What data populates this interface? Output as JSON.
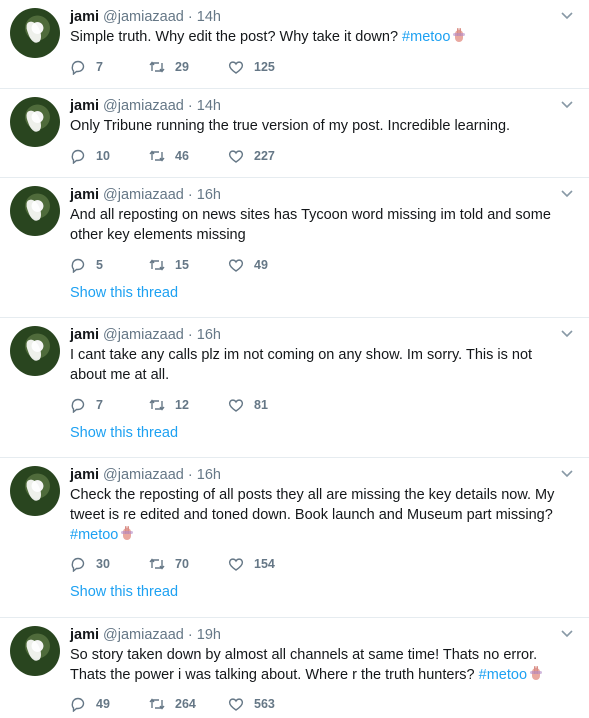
{
  "user": {
    "name": "jami",
    "handle": "@jamiazaad",
    "separator": "·"
  },
  "tweets": [
    {
      "time": "14h",
      "text": "Simple truth. Why edit the post? Why take it down?",
      "hashtag": "#metoo",
      "has_emoji": true,
      "replies": "7",
      "retweets": "29",
      "likes": "125",
      "show_thread": ""
    },
    {
      "time": "14h",
      "text": "Only Tribune running the true version of my post. Incredible learning.",
      "hashtag": "",
      "replies": "10",
      "retweets": "46",
      "likes": "227",
      "show_thread": ""
    },
    {
      "time": "16h",
      "text": "And all reposting on news sites has Tycoon word missing im told and some other key elements missing",
      "hashtag": "",
      "replies": "5",
      "retweets": "15",
      "likes": "49",
      "show_thread": "Show this thread"
    },
    {
      "time": "16h",
      "text": "I cant take any calls plz im not coming on any show. Im sorry. This is not about me at all.",
      "hashtag": "",
      "replies": "7",
      "retweets": "12",
      "likes": "81",
      "show_thread": "Show this thread"
    },
    {
      "time": "16h",
      "text": "Check the reposting of all posts they all are missing the key details now. My tweet is re edited and toned down. Book launch and Museum part missing?",
      "hashtag": "#metoo",
      "has_emoji": true,
      "replies": "30",
      "retweets": "70",
      "likes": "154",
      "show_thread": "Show this thread"
    },
    {
      "time": "19h",
      "text": "So story taken down by almost all channels at same time! Thats no error. Thats the power i was talking about. Where r the truth hunters?",
      "hashtag": "#metoo",
      "has_emoji": true,
      "replies": "49",
      "retweets": "264",
      "likes": "563",
      "show_thread": ""
    }
  ],
  "icons": {
    "reply": "reply-icon",
    "retweet": "retweet-icon",
    "like": "heart-icon",
    "menu": "chevron-down-icon",
    "emoji": "raised-hand-emoji"
  },
  "colors": {
    "link": "#1da1f2",
    "muted": "#657786",
    "text": "#14171a",
    "divider": "#e6ecf0"
  }
}
